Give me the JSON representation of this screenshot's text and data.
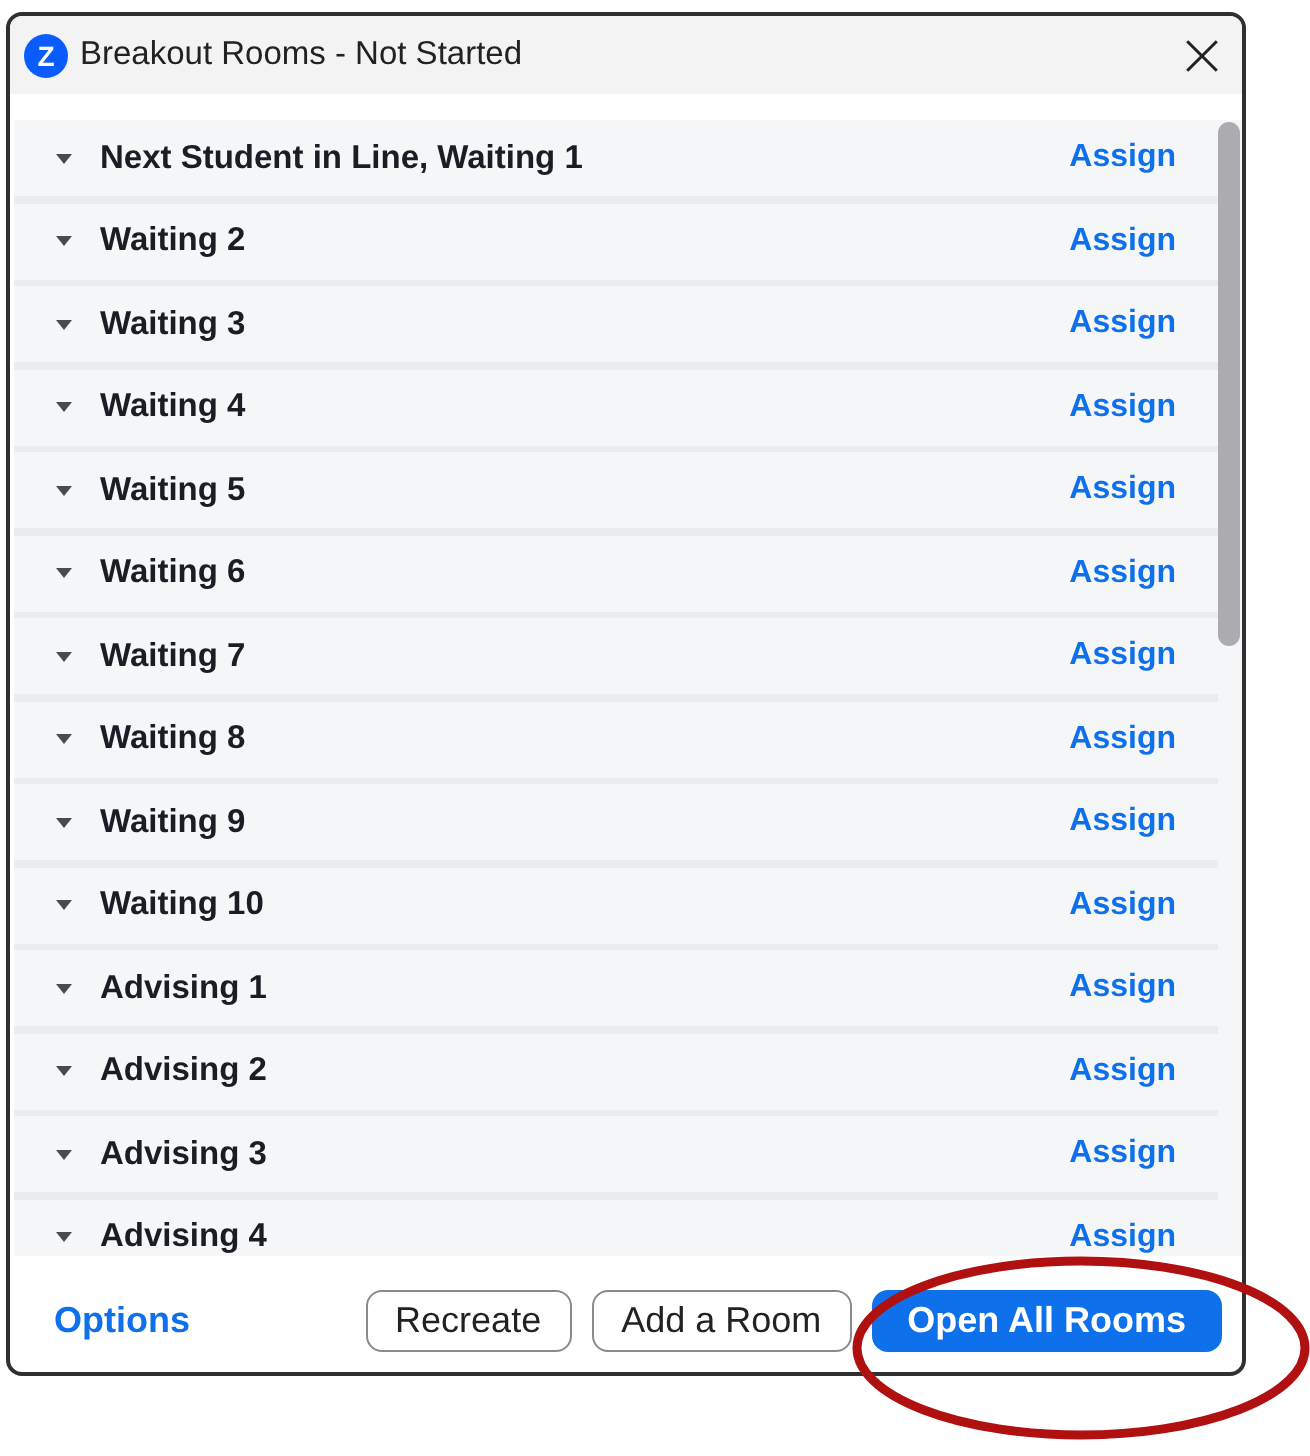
{
  "window": {
    "logo": "Z",
    "title": "Breakout Rooms - Not Started"
  },
  "rooms": [
    {
      "name": "Next Student in Line, Waiting 1",
      "action": "Assign"
    },
    {
      "name": "Waiting 2",
      "action": "Assign"
    },
    {
      "name": "Waiting 3",
      "action": "Assign"
    },
    {
      "name": "Waiting 4",
      "action": "Assign"
    },
    {
      "name": "Waiting 5",
      "action": "Assign"
    },
    {
      "name": "Waiting 6",
      "action": "Assign"
    },
    {
      "name": "Waiting 7",
      "action": "Assign"
    },
    {
      "name": "Waiting 8",
      "action": "Assign"
    },
    {
      "name": "Waiting 9",
      "action": "Assign"
    },
    {
      "name": "Waiting 10",
      "action": "Assign"
    },
    {
      "name": "Advising 1",
      "action": "Assign"
    },
    {
      "name": "Advising 2",
      "action": "Assign"
    },
    {
      "name": "Advising 3",
      "action": "Assign"
    },
    {
      "name": "Advising 4",
      "action": "Assign"
    }
  ],
  "footer": {
    "options": "Options",
    "buttons": [
      {
        "label": "Recreate",
        "kind": "outline"
      },
      {
        "label": "Add a Room",
        "kind": "outline"
      },
      {
        "label": "Open All Rooms",
        "kind": "primary"
      }
    ]
  }
}
